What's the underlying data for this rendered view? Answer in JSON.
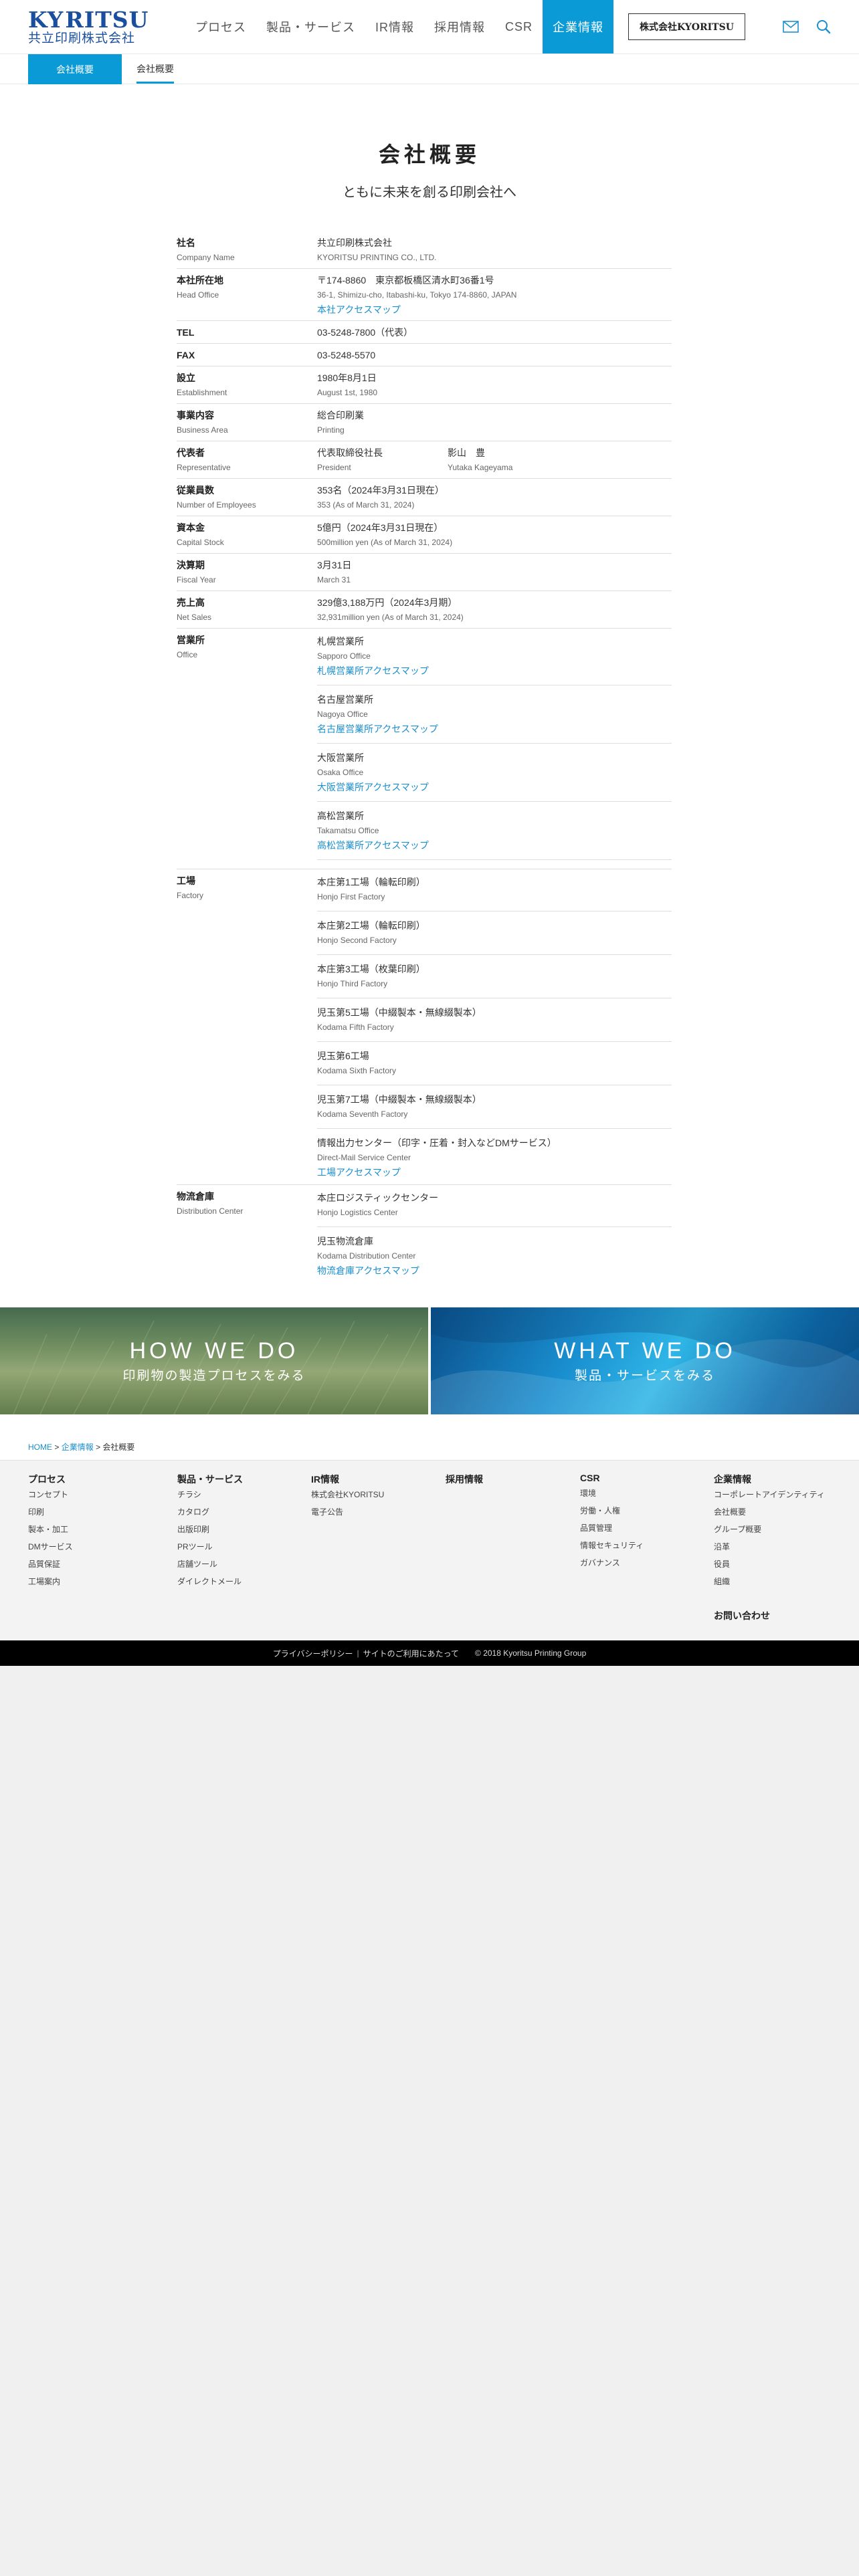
{
  "header": {
    "logo_word_a": "KY",
    "logo_word_b": "RITSU",
    "logo_sub": "共立印刷株式会社",
    "nav": [
      "プロセス",
      "製品・サービス",
      "IR情報",
      "採用情報",
      "CSR",
      "企業情報"
    ],
    "active_nav": "企業情報",
    "corp_button": "株式会社KYORITSU",
    "icons": [
      "mail-icon",
      "search-icon"
    ]
  },
  "subnav": {
    "category": "会社概要",
    "item": "会社概要"
  },
  "main": {
    "title": "会社概要",
    "lead": "ともに未来を創る印刷会社へ",
    "rows": {
      "name": {
        "jp": "社名",
        "en": "Company Name",
        "v_jp": "共立印刷株式会社",
        "v_en": "KYORITSU PRINTING CO., LTD."
      },
      "head": {
        "jp": "本社所在地",
        "en": "Head Office",
        "v_jp": "〒174-8860　東京都板橋区清水町36番1号",
        "v_en": "36-1, Shimizu-cho, Itabashi-ku, Tokyo 174-8860, JAPAN",
        "link": "本社アクセスマップ"
      },
      "tel": {
        "jp": "TEL",
        "v_jp": "03-5248-7800（代表）"
      },
      "fax": {
        "jp": "FAX",
        "v_jp": "03-5248-5570"
      },
      "est": {
        "jp": "設立",
        "en": "Establishment",
        "v_jp": "1980年8月1日",
        "v_en": "August 1st, 1980"
      },
      "biz": {
        "jp": "事業内容",
        "en": "Business Area",
        "v_jp": "総合印刷業",
        "v_en": "Printing"
      },
      "rep": {
        "jp": "代表者",
        "en": "Representative",
        "role_jp": "代表取締役社長",
        "role_en": "President",
        "person_jp": "影山　豊",
        "person_en": "Yutaka Kageyama"
      },
      "emp": {
        "jp": "従業員数",
        "en": "Number of Employees",
        "v_jp": "353名（2024年3月31日現在）",
        "v_en": "353 (As of March 31, 2024)"
      },
      "cap": {
        "jp": "資本金",
        "en": "Capital Stock",
        "v_jp": "5億円（2024年3月31日現在）",
        "v_en": "500million yen (As of March 31, 2024)"
      },
      "fiscal": {
        "jp": "決算期",
        "en": "Fiscal Year",
        "v_jp": "3月31日",
        "v_en": "March 31"
      },
      "sales": {
        "jp": "売上高",
        "en": "Net Sales",
        "v_jp": "329億3,188万円（2024年3月期）",
        "v_en": "32,931million yen (As of March 31, 2024)"
      }
    },
    "offices": {
      "jp": "営業所",
      "en": "Office",
      "items": [
        {
          "jp": "札幌営業所",
          "en": "Sapporo Office",
          "link": "札幌営業所アクセスマップ"
        },
        {
          "jp": "名古屋営業所",
          "en": "Nagoya Office",
          "link": "名古屋営業所アクセスマップ"
        },
        {
          "jp": "大阪営業所",
          "en": "Osaka Office",
          "link": "大阪営業所アクセスマップ"
        },
        {
          "jp": "高松営業所",
          "en": "Takamatsu Office",
          "link": "高松営業所アクセスマップ"
        }
      ]
    },
    "factories": {
      "jp": "工場",
      "en": "Factory",
      "items": [
        {
          "jp": "本庄第1工場（輪転印刷）",
          "en": "Honjo First Factory"
        },
        {
          "jp": "本庄第2工場（輪転印刷）",
          "en": "Honjo Second Factory"
        },
        {
          "jp": "本庄第3工場（枚葉印刷）",
          "en": "Honjo Third Factory"
        },
        {
          "jp": "児玉第5工場（中綴製本・無線綴製本）",
          "en": "Kodama Fifth Factory"
        },
        {
          "jp": "児玉第6工場",
          "en": "Kodama Sixth Factory"
        },
        {
          "jp": "児玉第7工場（中綴製本・無線綴製本）",
          "en": "Kodama Seventh Factory"
        },
        {
          "jp": "情報出力センター（印字・圧着・封入などDMサービス）",
          "en": "Direct-Mail Service Center"
        }
      ],
      "link": "工場アクセスマップ"
    },
    "distribution": {
      "jp": "物流倉庫",
      "en": "Distribution Center",
      "items": [
        {
          "jp": "本庄ロジスティックセンター",
          "en": "Honjo Logistics Center"
        },
        {
          "jp": "児玉物流倉庫",
          "en": "Kodama Distribution Center"
        }
      ],
      "link": "物流倉庫アクセスマップ"
    }
  },
  "banners": {
    "how": {
      "title": "HOW WE DO",
      "sub": "印刷物の製造プロセスをみる"
    },
    "what": {
      "title": "WHAT WE DO",
      "sub": "製品・サービスをみる"
    }
  },
  "breadcrumb": {
    "home": "HOME",
    "sep": ">",
    "parent": "企業情報",
    "current": "会社概要"
  },
  "footer": {
    "cols": [
      {
        "title": "プロセス",
        "items": [
          "コンセプト",
          "印刷",
          "製本・加工",
          "DMサービス",
          "品質保証",
          "工場案内"
        ]
      },
      {
        "title": "製品・サービス",
        "items": [
          "チラシ",
          "カタログ",
          "出版印刷",
          "PRツール",
          "店舗ツール",
          "ダイレクトメール"
        ]
      },
      {
        "title": "IR情報",
        "items": [
          "株式会社KYORITSU",
          "電子公告"
        ]
      },
      {
        "title": "採用情報",
        "items": []
      },
      {
        "title": "CSR",
        "items": [
          "環境",
          "労働・人権",
          "品質管理",
          "情報セキュリティ",
          "ガバナンス"
        ]
      },
      {
        "title": "企業情報",
        "items": [
          "コーポレートアイデンティティ",
          "会社概要",
          "グループ概要",
          "沿革",
          "役員",
          "組織"
        ]
      }
    ],
    "contact": "お問い合わせ",
    "bottom": {
      "privacy": "プライバシーポリシー",
      "sep": "|",
      "terms": "サイトのご利用にあたって",
      "copyright": "© 2018 Kyoritsu Printing Group"
    }
  }
}
